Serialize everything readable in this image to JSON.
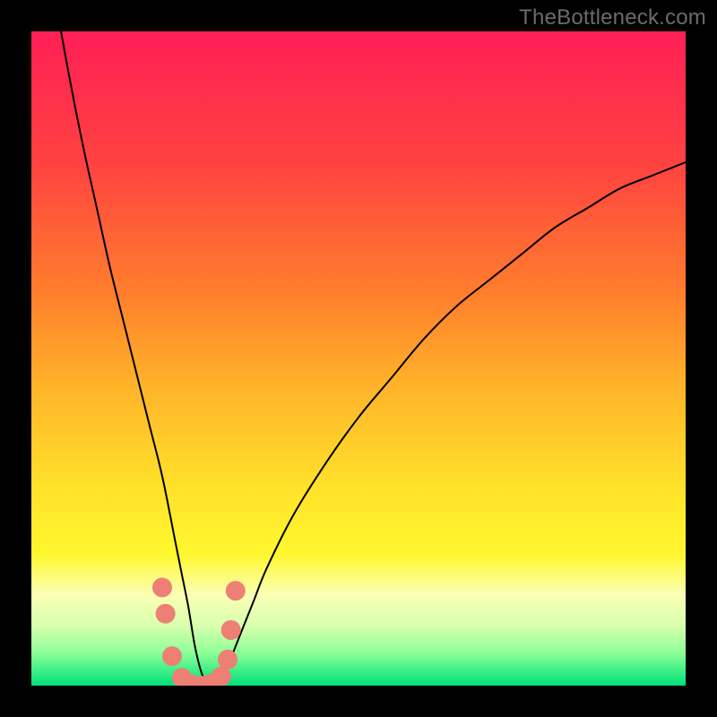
{
  "watermark": "TheBottleneck.com",
  "chart_data": {
    "type": "line",
    "title": "",
    "xlabel": "",
    "ylabel": "",
    "xlim": [
      0,
      100
    ],
    "ylim": [
      0,
      100
    ],
    "grid": false,
    "legend": false,
    "background_gradient": {
      "stops": [
        {
          "offset": 0.0,
          "color": "#ff1f55"
        },
        {
          "offset": 0.2,
          "color": "#ff4241"
        },
        {
          "offset": 0.4,
          "color": "#ff7e2c"
        },
        {
          "offset": 0.55,
          "color": "#ffb62a"
        },
        {
          "offset": 0.7,
          "color": "#ffe22a"
        },
        {
          "offset": 0.8,
          "color": "#fff72f"
        },
        {
          "offset": 0.86,
          "color": "#fbffb4"
        },
        {
          "offset": 0.91,
          "color": "#d7ffae"
        },
        {
          "offset": 0.95,
          "color": "#8cff97"
        },
        {
          "offset": 1.0,
          "color": "#00e07a"
        }
      ]
    },
    "series": [
      {
        "name": "curve",
        "color": "#000000",
        "width": 2,
        "x": [
          0,
          2,
          4,
          6,
          8,
          10,
          12,
          14,
          16,
          18,
          20,
          22,
          23,
          24,
          25,
          26,
          27,
          28,
          29,
          30,
          32,
          34,
          36,
          40,
          45,
          50,
          55,
          60,
          65,
          70,
          75,
          80,
          85,
          90,
          95,
          100
        ],
        "y": [
          128,
          115,
          103,
          92,
          82,
          73,
          64,
          56,
          48,
          40,
          32,
          22,
          17,
          12,
          6,
          2,
          0,
          0,
          1,
          3,
          8,
          13,
          18,
          26,
          34,
          41,
          47,
          53,
          58,
          62,
          66,
          70,
          73,
          76,
          78,
          80
        ]
      },
      {
        "name": "dots",
        "color": "#ee7f74",
        "type": "scatter",
        "radius": 11,
        "x": [
          20.0,
          20.5,
          21.5,
          23.0,
          24.5,
          26.0,
          27.5,
          29.0,
          30.0,
          30.5,
          31.2
        ],
        "y": [
          15.0,
          11.0,
          4.5,
          1.2,
          0.2,
          0.0,
          0.3,
          1.4,
          4.0,
          8.5,
          14.5
        ]
      }
    ]
  }
}
